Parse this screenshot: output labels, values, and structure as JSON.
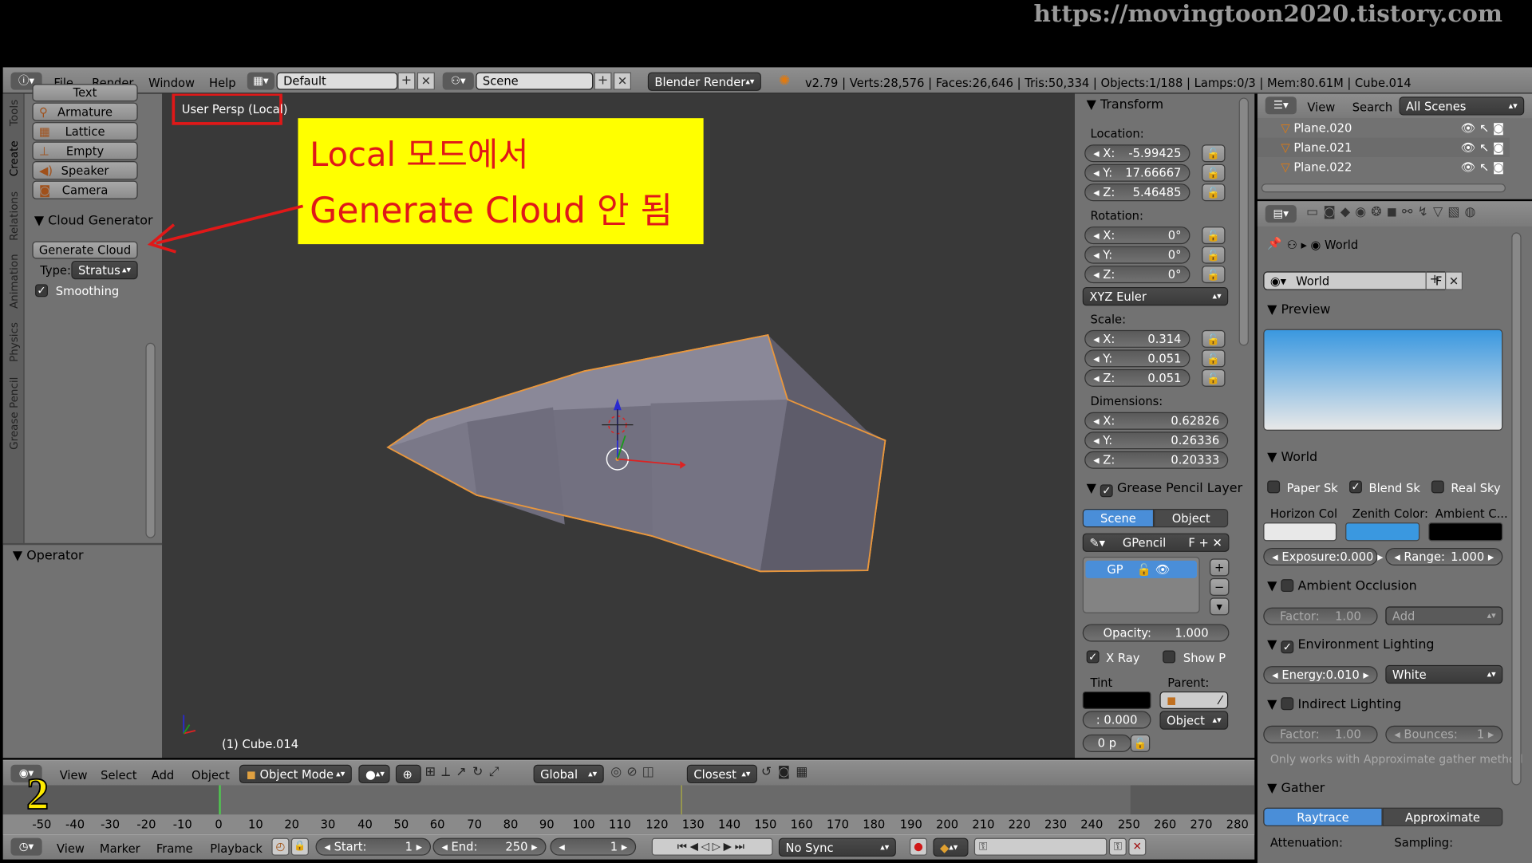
{
  "watermark": "https://movingtoon2020.tistory.com",
  "topbar": {
    "menus": [
      "File",
      "Render",
      "Window",
      "Help"
    ],
    "layout": "Default",
    "scene": "Scene",
    "engine": "Blender Render",
    "stats": "v2.79 | Verts:28,576 | Faces:26,646 | Tris:50,334 | Objects:1/188 | Lamps:0/3 | Mem:80.61M | Cube.014"
  },
  "left": {
    "tabs": [
      "Tools",
      "Create",
      "Relations",
      "Animation",
      "Physics",
      "Grease Pencil"
    ],
    "create_items": [
      "Text",
      "Armature",
      "Lattice",
      "Empty",
      "Speaker",
      "Camera"
    ],
    "cloud_header": "Cloud Generator",
    "generate_label": "Generate Cloud",
    "type_label": "Type:",
    "type_value": "Stratus",
    "smoothing": "Smoothing",
    "operator": "Operator"
  },
  "viewport": {
    "label": "User Persp (Local)",
    "object": "(1) Cube.014"
  },
  "annotation": {
    "line1": "Local 모드에서",
    "line2": "Generate Cloud 안 됨"
  },
  "transform": {
    "header": "Transform",
    "location_label": "Location:",
    "loc": [
      "-5.99425",
      "17.66667",
      "5.46485"
    ],
    "rotation_label": "Rotation:",
    "rot": [
      "0°",
      "0°",
      "0°"
    ],
    "euler": "XYZ Euler",
    "scale_label": "Scale:",
    "scale": [
      "0.314",
      "0.051",
      "0.051"
    ],
    "dimensions_label": "Dimensions:",
    "dim": [
      "0.62826",
      "0.26336",
      "0.20333"
    ],
    "axes": [
      "X:",
      "Y:",
      "Z:"
    ]
  },
  "gpencil": {
    "header": "Grease Pencil Layer",
    "tab_scene": "Scene",
    "tab_object": "Object",
    "name": "GPencil",
    "f": "F",
    "layer": "GP",
    "opacity_label": "Opacity:",
    "opacity": "1.000",
    "xray": "X Ray",
    "showp": "Show P",
    "tint": "Tint",
    "parent": "Parent:",
    "tint_val": ": 0.000",
    "parent_val": "Object",
    "op": "0 p"
  },
  "outliner": {
    "view": "View",
    "search": "Search",
    "scenes": "All Scenes",
    "rows": [
      "Plane.020",
      "Plane.021",
      "Plane.022"
    ]
  },
  "world": {
    "crumb": "World",
    "name": "World",
    "f": "F",
    "preview": "Preview",
    "world_hdr": "World",
    "paper": "Paper Sk",
    "blend": "Blend Sk",
    "real": "Real Sky",
    "horizon": "Horizon Col",
    "zenith": "Zenith Color:",
    "ambient": "Ambient C...",
    "exposure_label": "Exposure:",
    "exposure": "0.000",
    "range_label": "Range:",
    "range": "1.000",
    "ao": "Ambient Occlusion",
    "ao_factor_label": "Factor:",
    "ao_factor": "1.00",
    "ao_add": "Add",
    "env": "Environment Lighting",
    "energy_label": "Energy:",
    "energy": "0.010",
    "env_white": "White",
    "indirect": "Indirect Lighting",
    "ind_factor_label": "Factor:",
    "ind_factor": "1.00",
    "bounces_label": "Bounces:",
    "bounces": "1",
    "note": "Only works with Approximate gather method",
    "gather": "Gather",
    "raytrace": "Raytrace",
    "approximate": "Approximate",
    "atten": "Attenuation:",
    "sampling": "Sampling:",
    "colors": {
      "horizon": "#e8e8e8",
      "zenith": "#3a98e0",
      "ambient": "#000000"
    }
  },
  "vp_header": {
    "menus": [
      "View",
      "Select",
      "Add",
      "Object"
    ],
    "mode": "Object Mode",
    "orient": "Global",
    "snap": "Closest"
  },
  "timeline": {
    "ticks": [
      "-50",
      "-40",
      "-30",
      "-20",
      "-10",
      "0",
      "10",
      "20",
      "30",
      "40",
      "50",
      "60",
      "70",
      "80",
      "90",
      "100",
      "110",
      "120",
      "130",
      "140",
      "150",
      "160",
      "170",
      "180",
      "190",
      "200",
      "210",
      "220",
      "230",
      "240",
      "250",
      "260",
      "270",
      "280"
    ],
    "menus": [
      "View",
      "Marker",
      "Frame",
      "Playback"
    ],
    "start_label": "Start:",
    "start": "1",
    "end_label": "End:",
    "end": "250",
    "current": "1",
    "sync": "No Sync",
    "step_badge": "2"
  }
}
